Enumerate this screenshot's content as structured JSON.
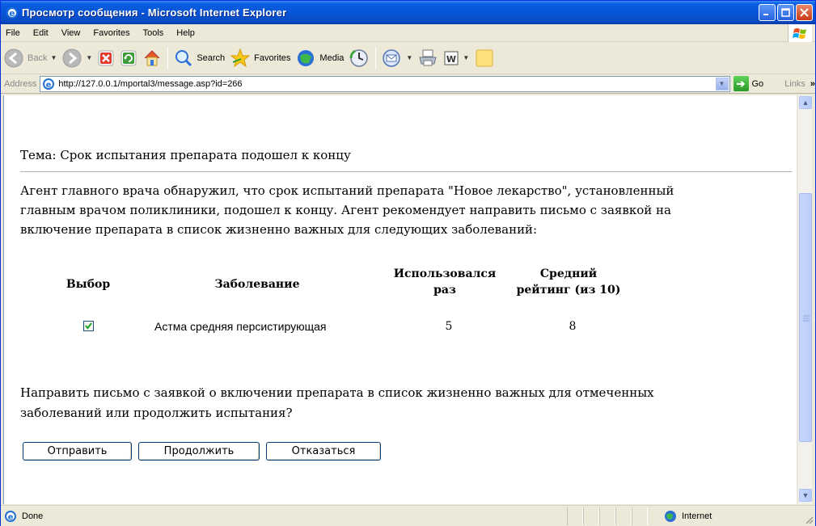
{
  "window": {
    "title": "Просмотр сообщения - Microsoft Internet Explorer"
  },
  "menu": [
    "File",
    "Edit",
    "View",
    "Favorites",
    "Tools",
    "Help"
  ],
  "toolbar": {
    "back_label": "Back",
    "search_label": "Search",
    "favorites_label": "Favorites",
    "media_label": "Media"
  },
  "address": {
    "label": "Address",
    "url": "http://127.0.0.1/mportal3/message.asp?id=266",
    "go_label": "Go",
    "links_label": "Links"
  },
  "message": {
    "subject": "Тема: Срок испытания препарата подошел к концу",
    "body_lines": [
      "Агент главного врача обнаружил, что срок испытаний препарата \"Новое лекарство\", установленный",
      "главным врачом поликлиники, подошел к концу. Агент рекомендует направить письмо с заявкой на",
      "включение препарата в список жизненно важных для следующих заболеваний:"
    ],
    "table": {
      "headers": {
        "select": "Выбор",
        "disease": "Заболевание",
        "used_line1": "Использовался",
        "used_line2": "раз",
        "rating_line1": "Средний",
        "rating_line2": "рейтинг (из 10)"
      },
      "rows": [
        {
          "checked": true,
          "disease": "Астма средняя персистирующая",
          "used": "5",
          "rating": "8"
        }
      ]
    },
    "question_lines": [
      "Направить письмо с заявкой о включении препарата в список жизненно важных для отмеченных",
      "заболеваний или продолжить испытания?"
    ],
    "buttons": {
      "send": "Отправить",
      "continue": "Продолжить",
      "decline": "Отказаться"
    }
  },
  "status": {
    "text": "Done",
    "zone": "Internet"
  }
}
